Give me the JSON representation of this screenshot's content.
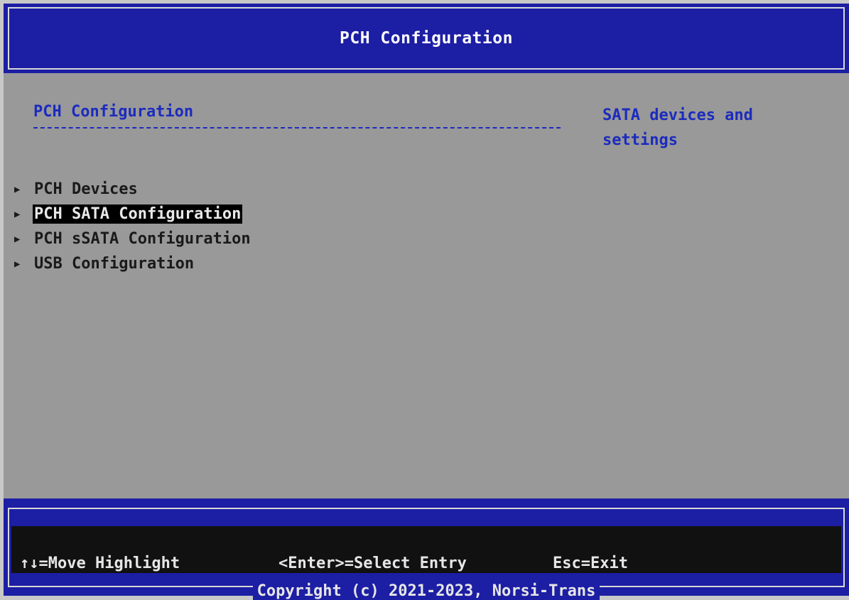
{
  "header": {
    "title": "PCH Configuration"
  },
  "main": {
    "section_title": "PCH Configuration",
    "help_text": "SATA devices and settings",
    "menu": [
      {
        "label": "PCH Devices",
        "selected": false
      },
      {
        "label": "PCH SATA Configuration",
        "selected": true
      },
      {
        "label": "PCH sSATA Configuration",
        "selected": false
      },
      {
        "label": "USB Configuration",
        "selected": false
      }
    ]
  },
  "footer": {
    "move_hint": "↑↓=Move Highlight",
    "select_hint": "<Enter>=Select Entry",
    "exit_hint": "Esc=Exit",
    "copyright": "Copyright (c) 2021-2023, Norsi-Trans"
  },
  "colors": {
    "header_bg": "#1c1ea4",
    "body_bg": "#999999",
    "accent_text": "#1c2bbd",
    "selected_bg": "#000000"
  },
  "icons": {
    "submenu": "triangle-right-icon"
  }
}
